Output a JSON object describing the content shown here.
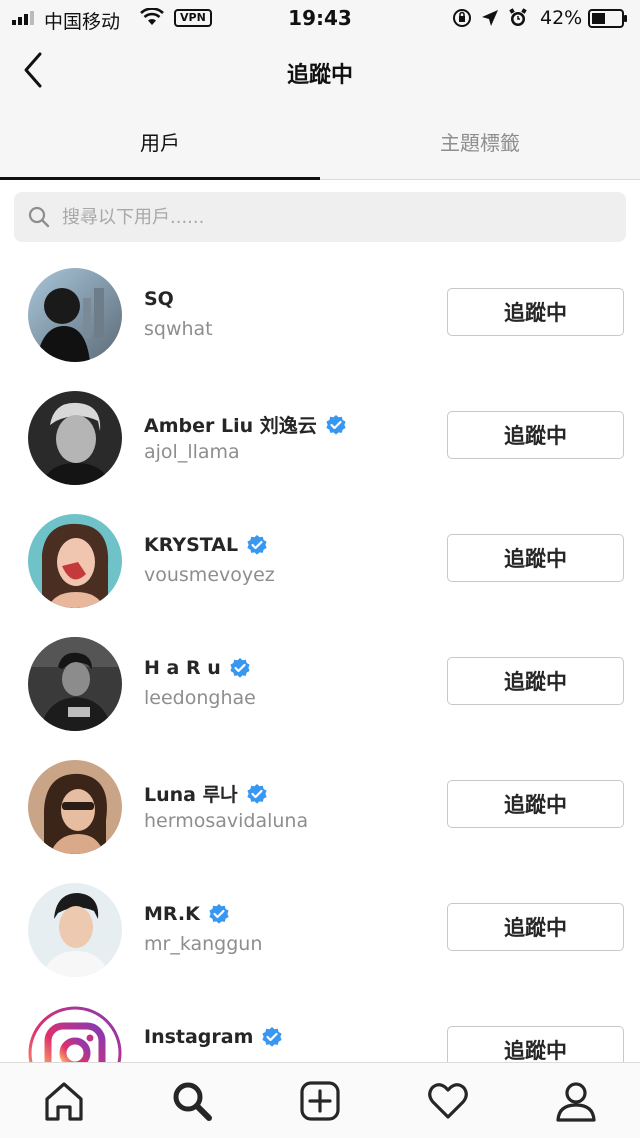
{
  "status_bar": {
    "carrier": "中国移动",
    "vpn": "VPN",
    "time": "19:43",
    "battery": "42%"
  },
  "header": {
    "title": "追蹤中"
  },
  "tabs": [
    {
      "label": "用戶",
      "active": true
    },
    {
      "label": "主題標籤",
      "active": false
    }
  ],
  "search": {
    "placeholder": "搜尋以下用戶......"
  },
  "following_label": "追蹤中",
  "users": [
    {
      "name": "SQ",
      "handle": "sqwhat",
      "verified": false
    },
    {
      "name": "Amber Liu 刘逸云",
      "handle": "ajol_llama",
      "verified": true
    },
    {
      "name": "KRYSTAL",
      "handle": "vousmevoyez",
      "verified": true
    },
    {
      "name": "H a R u",
      "handle": "leedonghae",
      "verified": true
    },
    {
      "name": "Luna 루나",
      "handle": "hermosavidaluna",
      "verified": true
    },
    {
      "name": "MR.K",
      "handle": "mr_kanggun",
      "verified": true
    },
    {
      "name": "Instagram",
      "handle": "",
      "verified": true
    }
  ],
  "bottom_nav": [
    "home-icon",
    "search-icon",
    "add-post-icon",
    "activity-heart-icon",
    "profile-icon"
  ],
  "colors": {
    "verified_blue": "#3897f0",
    "secondary_text": "#8e8e8e",
    "header_bg": "#f6f6f6"
  }
}
